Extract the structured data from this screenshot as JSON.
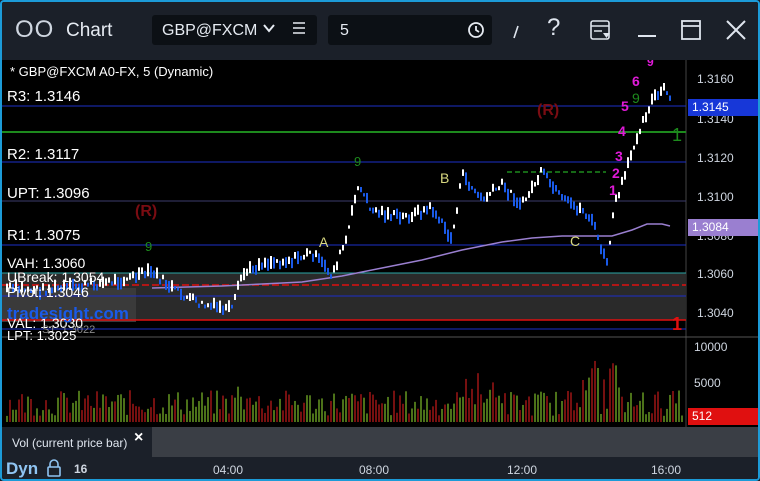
{
  "titlebar": {
    "app_title": "Chart",
    "app_icon": "OO",
    "symbol": "GBP@FXCM",
    "interval": "5",
    "icons": [
      "menu-icon",
      "clock-icon",
      "pen-icon",
      "help-icon",
      "template-icon",
      "minimize-icon",
      "maximize-icon",
      "close-icon"
    ]
  },
  "legend": "* GBP@FXCM A0-FX, 5 (Dynamic)",
  "levels": {
    "r3": "R3: 1.3146",
    "r2": "R2: 1.3117",
    "upt": "UPT: 1.3096",
    "r1": "R1: 1.3075",
    "vah": "VAH: 1.3060",
    "ubreak": "UBreak: 1.3054",
    "pivot": "Pivot: 1.3046",
    "val": "VAL: 1.3030",
    "lpt": "LPT: 1.3025",
    "s1": "S1: 1.3022"
  },
  "watermark": "tradesight.com",
  "annotations": {
    "r_left": "(R)",
    "r_right": "(R)",
    "a1": "A",
    "a2": "A",
    "b": "B",
    "c": "C",
    "seq": [
      "1",
      "2",
      "3",
      "4",
      "5",
      "6",
      "9"
    ],
    "one_green": "1",
    "one_red": "1",
    "nine_green": "9"
  },
  "price_axis": {
    "ticks": [
      "1.3160",
      "1.3140",
      "1.3120",
      "1.3100",
      "1.3080",
      "1.3060",
      "1.3040"
    ],
    "current_tag": "1.3145",
    "ma_tag": "1.3084"
  },
  "volume_axis": {
    "ticks": [
      "10000",
      "5000"
    ],
    "current_tag": "512"
  },
  "volume_panel": {
    "label": "Vol (current price bar)"
  },
  "bottombar": {
    "mode": "Dyn",
    "date": "16",
    "times": [
      "04:00",
      "08:00",
      "12:00",
      "16:00"
    ]
  },
  "colors": {
    "accent": "#1c9bd8",
    "up_bar": "#ffffff",
    "down_bar": "#1a5ae8",
    "ma": "#9a7fd0",
    "current_tag": "#1737d8",
    "vol_tag": "#e01010"
  }
}
